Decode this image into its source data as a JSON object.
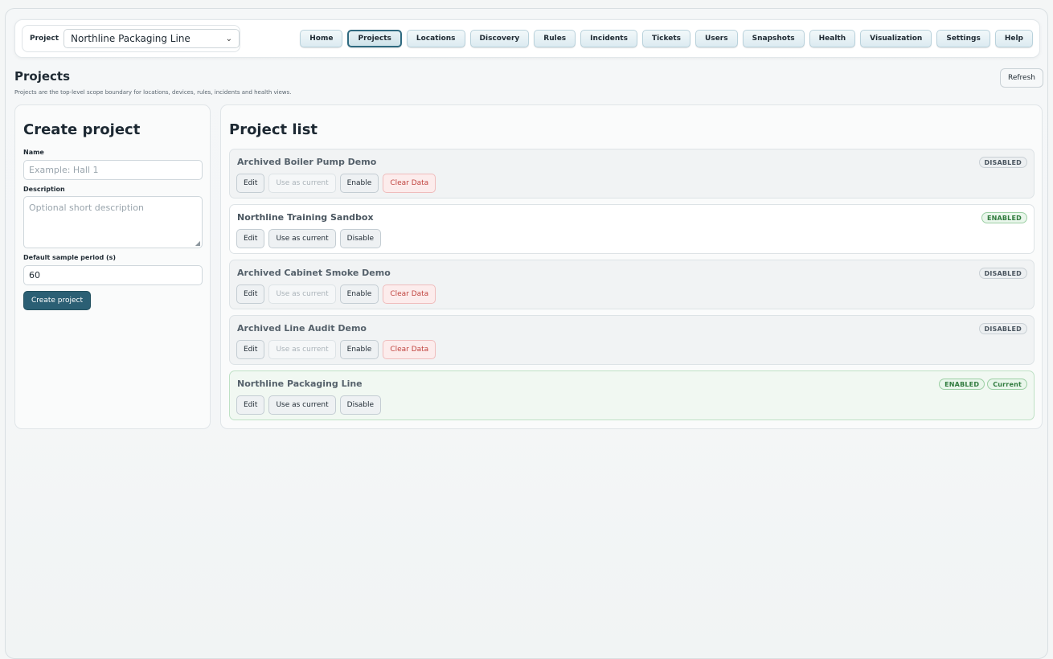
{
  "topbar": {
    "project_label": "Project",
    "selected_project": "Northline Packaging Line",
    "nav": [
      "Home",
      "Projects",
      "Locations",
      "Discovery",
      "Rules",
      "Incidents",
      "Tickets",
      "Users",
      "Snapshots",
      "Health",
      "Visualization",
      "Settings",
      "Help"
    ],
    "active_nav": "Projects"
  },
  "page": {
    "title": "Projects",
    "subtitle": "Projects are the top-level scope boundary for locations, devices, rules, incidents and health views.",
    "refresh_label": "Refresh"
  },
  "create_form": {
    "title": "Create project",
    "name_label": "Name",
    "name_placeholder": "Example: Hall 1",
    "description_label": "Description",
    "description_placeholder": "Optional short description",
    "sample_period_label": "Default sample period (s)",
    "sample_period_value": "60",
    "submit_label": "Create project"
  },
  "project_list": {
    "title": "Project list",
    "labels": {
      "edit": "Edit",
      "use_as_current": "Use as current",
      "enable": "Enable",
      "disable": "Disable",
      "clear_data": "Clear Data"
    },
    "items": [
      {
        "name": "Archived Boiler Pump Demo",
        "status": "DISABLED",
        "current": false
      },
      {
        "name": "Northline Training Sandbox",
        "status": "ENABLED",
        "current": false
      },
      {
        "name": "Archived Cabinet Smoke Demo",
        "status": "DISABLED",
        "current": false
      },
      {
        "name": "Archived Line Audit Demo",
        "status": "DISABLED",
        "current": false
      },
      {
        "name": "Northline Packaging Line",
        "status": "ENABLED",
        "current": true,
        "current_label": "Current"
      }
    ]
  },
  "colors": {
    "primary": "#2b5f74",
    "enabled": "#2f7a3d",
    "danger": "#c0443f"
  }
}
